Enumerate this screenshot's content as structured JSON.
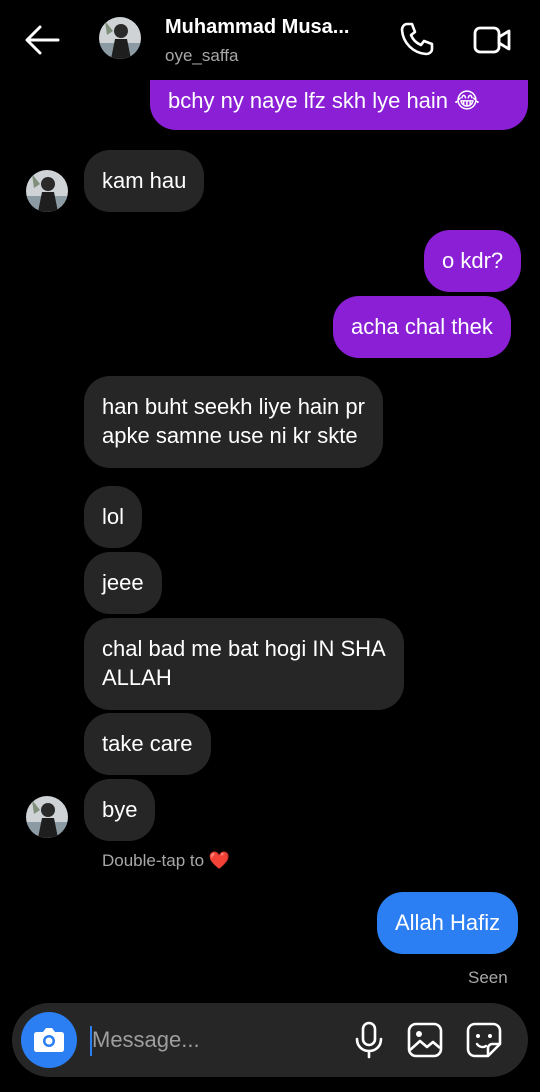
{
  "header": {
    "name": "Muhammad Musa...",
    "username": "oye_saffa"
  },
  "messages": [
    {
      "from": "me",
      "text": "bchy ny naye lfz skh lye hain 😂",
      "color": "#8a1fd6"
    },
    {
      "from": "them",
      "text": "kam hau"
    },
    {
      "from": "me",
      "text": "o kdr?",
      "color": "#8a1fd6"
    },
    {
      "from": "me",
      "text": "acha chal thek",
      "color": "#8a1fd6"
    },
    {
      "from": "them",
      "lines": [
        "han buht seekh liye hain pr",
        "apke samne use ni kr skte"
      ]
    },
    {
      "from": "them",
      "text": "lol"
    },
    {
      "from": "them",
      "text": "jeee"
    },
    {
      "from": "them",
      "lines": [
        "chal bad me bat hogi IN SHA",
        "ALLAH"
      ]
    },
    {
      "from": "them",
      "text": "take care"
    },
    {
      "from": "them",
      "text": "bye"
    },
    {
      "from": "me",
      "text": "Allah Hafiz",
      "color": "#2b7ff2"
    }
  ],
  "double_tap_hint": {
    "text": "Double-tap to",
    "icon": "heart-icon",
    "glyph": "❤️"
  },
  "seen_label": "Seen",
  "composer": {
    "placeholder": "Message..."
  },
  "colors": {
    "purple_bubble": "#8a1fd6",
    "blue_bubble": "#2b7ff2",
    "incoming_bubble": "#262626"
  }
}
